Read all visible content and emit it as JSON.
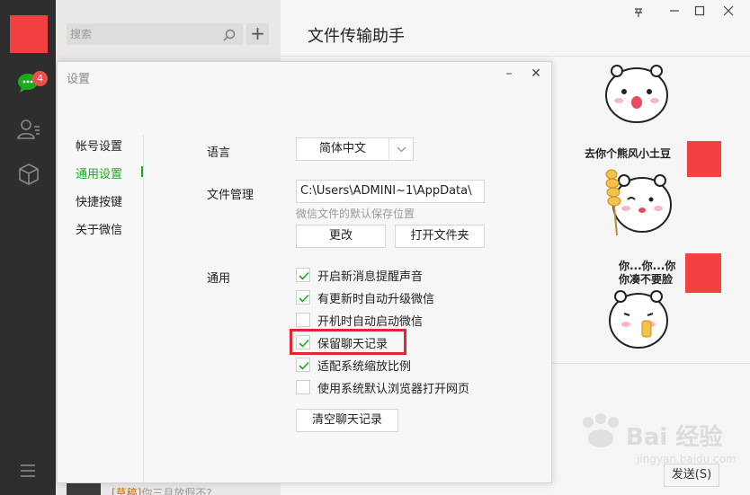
{
  "nav": {
    "unread_badge": "4",
    "avatar_color": "#f34040",
    "accent_color": "#1aad19",
    "icons": [
      "chat-icon",
      "contacts-icon",
      "box-icon",
      "menu-icon"
    ]
  },
  "conversation_list": {
    "search_placeholder": "搜索",
    "add_button_label": "+",
    "bottom_preview_tag": "[草稿]",
    "bottom_preview_text": "你三月放假不?"
  },
  "chat": {
    "title": "文件传输助手",
    "window_controls": [
      "pin",
      "minimize",
      "maximize",
      "close"
    ],
    "sticker_2_caption": "去你个熊风小土豆",
    "sticker_3_caption_line1": "你...你...你",
    "sticker_3_caption_line2": "你凑不要脸",
    "send_button": "发送(S)",
    "watermark": "Bai 经验",
    "watermark_sub": "jingyan.baidu.com"
  },
  "settings": {
    "title": "设置",
    "minimize_symbol": "–",
    "close_symbol": "✕",
    "sidebar": [
      {
        "label": "帐号设置",
        "active": false
      },
      {
        "label": "通用设置",
        "active": true
      },
      {
        "label": "快捷按键",
        "active": false
      },
      {
        "label": "关于微信",
        "active": false
      }
    ],
    "language": {
      "label": "语言",
      "value": "简体中文"
    },
    "file_management": {
      "label": "文件管理",
      "path": "C:\\Users\\ADMINI~1\\AppData\\",
      "hint": "微信文件的默认保存位置",
      "change_button": "更改",
      "open_folder_button": "打开文件夹"
    },
    "general": {
      "label": "通用",
      "options": [
        {
          "label": "开启新消息提醒声音",
          "checked": true
        },
        {
          "label": "有更新时自动升级微信",
          "checked": true
        },
        {
          "label": "开机时自动启动微信",
          "checked": false
        },
        {
          "label": "保留聊天记录",
          "checked": true,
          "highlighted": true
        },
        {
          "label": "适配系统缩放比例",
          "checked": true
        },
        {
          "label": "使用系统默认浏览器打开网页",
          "checked": false
        }
      ],
      "clear_history_button": "清空聊天记录"
    }
  }
}
